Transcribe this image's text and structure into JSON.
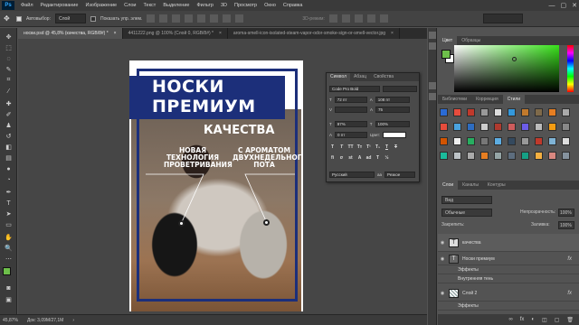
{
  "app": {
    "logo": "Ps",
    "window_controls": [
      "—",
      "▢",
      "✕"
    ]
  },
  "menu": [
    "Файл",
    "Редактирование",
    "Изображение",
    "Слои",
    "Текст",
    "Выделение",
    "Фильтр",
    "3D",
    "Просмотр",
    "Окно",
    "Справка"
  ],
  "options": {
    "autoselect_label": "Автовыбор:",
    "autoselect_value": "Слой",
    "show_controls_label": "Показать упр. элем.",
    "mode3d_label": "3D-режим:"
  },
  "tabs": [
    {
      "label": "носки.psd @ 45,8% (качества, RGB/8#) *",
      "close": "×"
    },
    {
      "label": "4411222.png @ 100% (Слой 0, RGB/8#) *",
      "close": "×"
    },
    {
      "label": "aroma-smell-icon-isolated-steam-vapor-odor-smoke-sign-or-smell-vector.jpg",
      "close": "×"
    }
  ],
  "status": {
    "zoom": "45,87%",
    "doc_size": "Док: 3,09M/27,1M",
    "arrow": "›"
  },
  "document": {
    "title_line1": "НОСКИ",
    "title_line2": "ПРЕМИУМ",
    "subtitle": "КАЧЕСТВА",
    "left_text": "НОВАЯ ТЕХНОЛОГИЯ ПРОВЕТРИВАНИЯ",
    "right_text": "С АРОМАТОМ ДВУХНЕДЕЛЬНОГО ПОТА",
    "colors": {
      "frame": "#1c2f7a",
      "banner": "#1c2f7a"
    }
  },
  "character_panel": {
    "tabs": [
      "Символ",
      "Абзац",
      "Свойства"
    ],
    "font": "Code Pro Bold",
    "size": "72 пт",
    "leading": "108 пт",
    "tracking": "75",
    "vscale": "97%",
    "hscale": "100%",
    "baseline": "0 пт",
    "color_label": "Цвет:",
    "style_buttons": [
      "T",
      "T",
      "TT",
      "Tт",
      "T¹",
      "T₁",
      "T",
      "T"
    ],
    "language": "Русский",
    "aa": "aa",
    "aa_mode": "Резкое"
  },
  "color_panel": {
    "tabs": [
      "Цвет",
      "Образцы"
    ],
    "fg": "#6dbf4a",
    "bg": "#ffffff"
  },
  "styles_panel": {
    "tabs": [
      "Библиотеки",
      "Коррекция",
      "Стили"
    ]
  },
  "layers_panel": {
    "tabs": [
      "Слои",
      "Каналы",
      "Контуры"
    ],
    "kind_label": "Вид",
    "blend_mode": "Обычные",
    "opacity_label": "Непрозрачность:",
    "opacity": "100%",
    "lock_label": "Закрепить:",
    "fill_label": "Заливка:",
    "fill": "100%",
    "layers": [
      {
        "name": "качества",
        "kind": "text",
        "fx": ""
      },
      {
        "name": "Носки премиум",
        "kind": "text",
        "fx": "fx"
      },
      {
        "name": "Эффекты",
        "kind": "effect",
        "fx": ""
      },
      {
        "name": "Внутренняя тень",
        "kind": "effect",
        "fx": ""
      },
      {
        "name": "Слой 2",
        "kind": "image",
        "fx": "fx"
      },
      {
        "name": "Эффекты",
        "kind": "effect",
        "fx": ""
      }
    ],
    "footer_icons": [
      "∞",
      "fx",
      "◐",
      "◫",
      "▢",
      "🗑"
    ]
  }
}
